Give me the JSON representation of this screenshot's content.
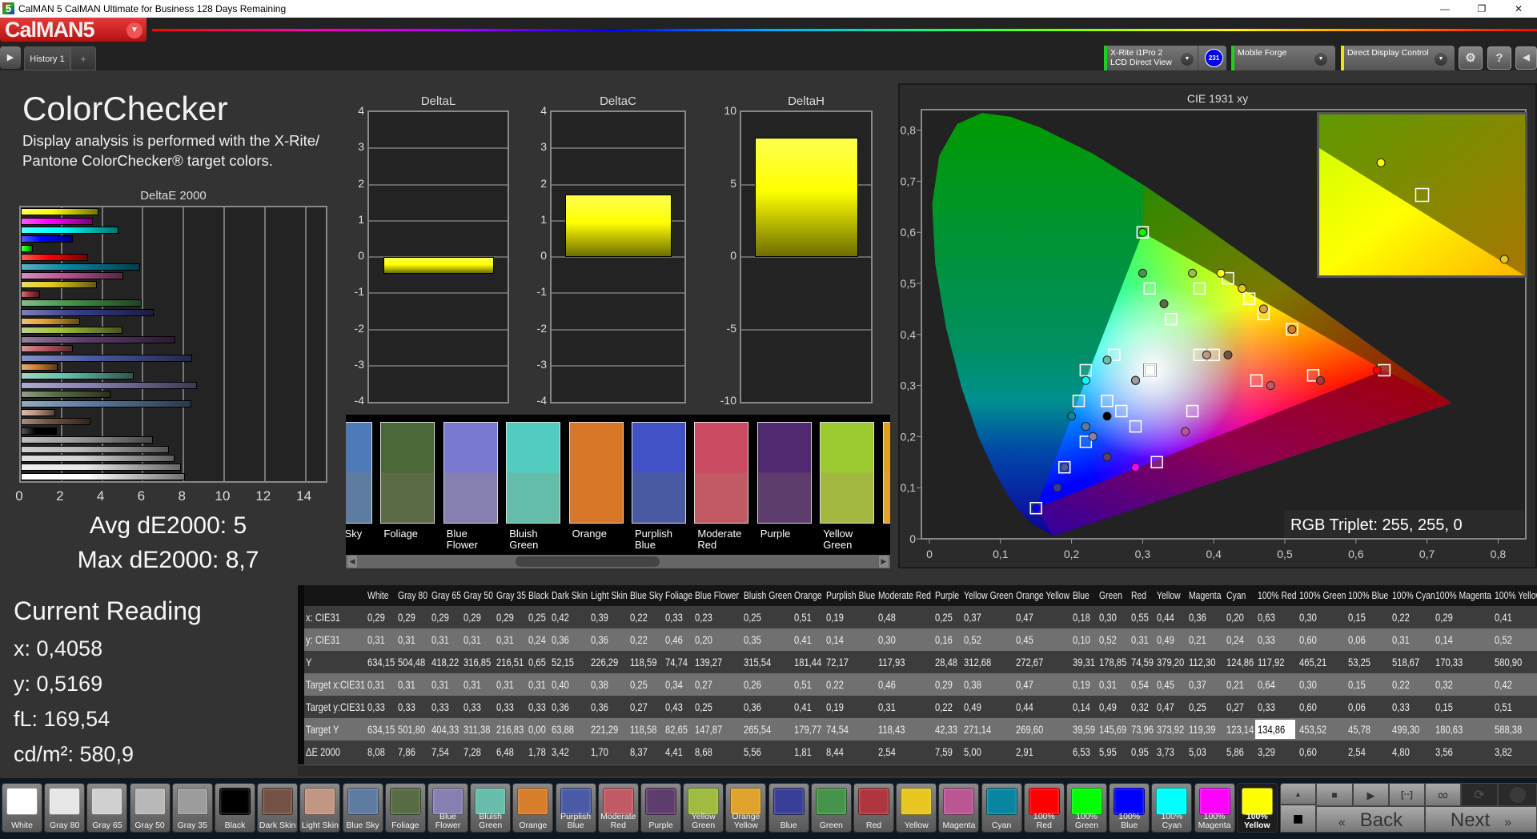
{
  "window": {
    "title": "CalMAN 5 CalMAN Ultimate for Business 128 Days Remaining",
    "app_icon": "5",
    "minimize": "—",
    "restore": "❐",
    "close": "✕"
  },
  "header": {
    "logo": "CalMAN5",
    "logo_menu_icon": "chevron-down"
  },
  "tabs": {
    "play_icon": "▶",
    "items": [
      {
        "label": "History 1"
      }
    ],
    "add": "+"
  },
  "devices": {
    "meter": {
      "line1": "X-Rite i1Pro 2",
      "line2": "LCD Direct View",
      "badge": "231",
      "status_color": "#22cc22"
    },
    "source": {
      "label": "Mobile Forge",
      "status_color": "#22cc22"
    },
    "display": {
      "label": "Direct Display Control",
      "status_color": "#e8e800"
    },
    "settings_icon": "⚙",
    "help_icon": "?",
    "back_icon": "◀"
  },
  "colors": {
    "logo_red": "#d32020",
    "badge_blue": "#0000ee",
    "panel_bg": "#333333",
    "plot_bg": "#232323"
  },
  "left": {
    "title": "ColorChecker",
    "desc_line1": "Display analysis is performed with the X-Rite/",
    "desc_line2": "Pantone ColorChecker® target colors.",
    "avg": "Avg dE2000: 5",
    "max": "Max dE2000: 8,7"
  },
  "current_reading": {
    "title": "Current Reading",
    "x": "x: 0,4058",
    "y": "y: 0,5169",
    "fl": "fL: 169,54",
    "cdm2": "cd/m²: 580,9"
  },
  "patches": [
    {
      "name": "White",
      "color": "#ffffff"
    },
    {
      "name": "Gray 80",
      "color": "#e6e6e6"
    },
    {
      "name": "Gray 65",
      "color": "#d0d0d0"
    },
    {
      "name": "Gray 50",
      "color": "#b8b8b8"
    },
    {
      "name": "Gray 35",
      "color": "#9c9c9c"
    },
    {
      "name": "Black",
      "color": "#000000"
    },
    {
      "name": "Dark Skin",
      "color": "#735244"
    },
    {
      "name": "Light Skin",
      "color": "#c29682"
    },
    {
      "name": "Blue Sky",
      "color": "#5e7ba0"
    },
    {
      "name": "Foliage",
      "color": "#576c43"
    },
    {
      "name": "Blue Flower",
      "color": "#8580b1"
    },
    {
      "name": "Bluish Green",
      "color": "#67bdaa"
    },
    {
      "name": "Orange",
      "color": "#d67e2c"
    },
    {
      "name": "Purplish Blue",
      "color": "#4a5aa6"
    },
    {
      "name": "Moderate Red",
      "color": "#c15a63"
    },
    {
      "name": "Purple",
      "color": "#5e3c6c"
    },
    {
      "name": "Yellow Green",
      "color": "#9dbc40"
    },
    {
      "name": "Orange Yellow",
      "color": "#e0a32e"
    },
    {
      "name": "Blue",
      "color": "#383d96"
    },
    {
      "name": "Green",
      "color": "#469449"
    },
    {
      "name": "Red",
      "color": "#af363c"
    },
    {
      "name": "Yellow",
      "color": "#e7c71f"
    },
    {
      "name": "Magenta",
      "color": "#bb5695"
    },
    {
      "name": "Cyan",
      "color": "#0885a1"
    },
    {
      "name": "100% Red",
      "color": "#ff0000"
    },
    {
      "name": "100% Green",
      "color": "#00ff00"
    },
    {
      "name": "100% Blue",
      "color": "#0000ff"
    },
    {
      "name": "100% Cyan",
      "color": "#00ffff"
    },
    {
      "name": "100% Magenta",
      "color": "#ff00ff"
    },
    {
      "name": "100% Yellow",
      "color": "#ffff00"
    }
  ],
  "selected_patch": "100% Yellow",
  "table": {
    "columns": [
      "White",
      "Gray 80",
      "Gray 65",
      "Gray 50",
      "Gray 35",
      "Black",
      "Dark Skin",
      "Light Skin",
      "Blue Sky",
      "Foliage",
      "Blue Flower",
      "Bluish Green",
      "Orange",
      "Purplish Blue",
      "Moderate Red",
      "Purple",
      "Yellow Green",
      "Orange Yellow",
      "Blue",
      "Green",
      "Red",
      "Yellow",
      "Magenta",
      "Cyan",
      "100% Red",
      "100% Green",
      "100% Blue",
      "100% Cyan",
      "100% Magenta",
      "100% Yellow"
    ],
    "rows": [
      {
        "label": "x: CIE31",
        "values": [
          "0,29",
          "0,29",
          "0,29",
          "0,29",
          "0,29",
          "0,25",
          "0,42",
          "0,39",
          "0,22",
          "0,33",
          "0,23",
          "0,25",
          "0,51",
          "0,19",
          "0,48",
          "0,25",
          "0,37",
          "0,47",
          "0,18",
          "0,30",
          "0,55",
          "0,44",
          "0,36",
          "0,20",
          "0,63",
          "0,30",
          "0,15",
          "0,22",
          "0,29",
          "0,41"
        ]
      },
      {
        "label": "y: CIE31",
        "values": [
          "0,31",
          "0,31",
          "0,31",
          "0,31",
          "0,31",
          "0,24",
          "0,36",
          "0,36",
          "0,22",
          "0,46",
          "0,20",
          "0,35",
          "0,41",
          "0,14",
          "0,30",
          "0,16",
          "0,52",
          "0,45",
          "0,10",
          "0,52",
          "0,31",
          "0,49",
          "0,21",
          "0,24",
          "0,33",
          "0,60",
          "0,06",
          "0,31",
          "0,14",
          "0,52"
        ]
      },
      {
        "label": "Y",
        "values": [
          "634,15",
          "504,48",
          "418,22",
          "316,85",
          "216,51",
          "0,65",
          "52,15",
          "226,29",
          "118,59",
          "74,74",
          "139,27",
          "315,54",
          "181,44",
          "72,17",
          "117,93",
          "28,48",
          "312,68",
          "272,67",
          "39,31",
          "178,85",
          "74,59",
          "379,20",
          "112,30",
          "124,86",
          "117,92",
          "465,21",
          "53,25",
          "518,67",
          "170,33",
          "580,90"
        ]
      },
      {
        "label": "Target x:CIE31",
        "values": [
          "0,31",
          "0,31",
          "0,31",
          "0,31",
          "0,31",
          "0,31",
          "0,40",
          "0,38",
          "0,25",
          "0,34",
          "0,27",
          "0,26",
          "0,51",
          "0,22",
          "0,46",
          "0,29",
          "0,38",
          "0,47",
          "0,19",
          "0,31",
          "0,54",
          "0,45",
          "0,37",
          "0,21",
          "0,64",
          "0,30",
          "0,15",
          "0,22",
          "0,32",
          "0,42"
        ]
      },
      {
        "label": "Target y:CIE31",
        "values": [
          "0,33",
          "0,33",
          "0,33",
          "0,33",
          "0,33",
          "0,33",
          "0,36",
          "0,36",
          "0,27",
          "0,43",
          "0,25",
          "0,36",
          "0,41",
          "0,19",
          "0,31",
          "0,22",
          "0,49",
          "0,44",
          "0,14",
          "0,49",
          "0,32",
          "0,47",
          "0,25",
          "0,27",
          "0,33",
          "0,60",
          "0,06",
          "0,33",
          "0,15",
          "0,51"
        ]
      },
      {
        "label": "Target Y",
        "values": [
          "634,15",
          "501,80",
          "404,33",
          "311,38",
          "216,83",
          "0,00",
          "63,88",
          "221,29",
          "118,58",
          "82,65",
          "147,87",
          "265,54",
          "179,77",
          "74,54",
          "118,43",
          "42,33",
          "271,14",
          "269,60",
          "39,59",
          "145,69",
          "73,96",
          "373,92",
          "119,39",
          "123,14",
          "134,86",
          "453,52",
          "45,78",
          "499,30",
          "180,63",
          "588,38"
        ]
      },
      {
        "label": "ΔE 2000",
        "values": [
          "8,08",
          "7,86",
          "7,54",
          "7,28",
          "6,48",
          "1,78",
          "3,42",
          "1,70",
          "8,37",
          "4,41",
          "8,68",
          "5,56",
          "1,81",
          "8,44",
          "2,54",
          "7,59",
          "5,00",
          "2,91",
          "6,53",
          "5,95",
          "0,95",
          "3,73",
          "5,03",
          "5,86",
          "3,29",
          "0,60",
          "2,54",
          "4,80",
          "3,56",
          "3,82"
        ]
      }
    ]
  },
  "strip": [
    {
      "label": "Blue Sky",
      "measured": "#4f7ab8",
      "target": "#5e7ba0"
    },
    {
      "label": "Foliage",
      "measured": "#4a6838",
      "target": "#5b6b45"
    },
    {
      "label": "Blue Flower",
      "measured": "#7878d0",
      "target": "#8580b1"
    },
    {
      "label": "Bluish Green",
      "measured": "#50cdc0",
      "target": "#64bca9"
    },
    {
      "label": "Orange",
      "measured": "#d87826",
      "target": "#d87826"
    },
    {
      "label": "Purplish Blue",
      "measured": "#4152c4",
      "target": "#4a5aa2"
    },
    {
      "label": "Moderate Red",
      "measured": "#ca4a64",
      "target": "#c15a63"
    },
    {
      "label": "Purple",
      "measured": "#522a72",
      "target": "#5e3c6c"
    },
    {
      "label": "Yellow Green",
      "measured": "#9aca30",
      "target": "#a3b840"
    },
    {
      "label": "",
      "measured": "#e0a020",
      "target": "#e0a32e"
    }
  ],
  "controls": {
    "up_icon": "▲",
    "stop_icon": "■",
    "play_icon": "▶",
    "bracket_icon": "[··]",
    "loop_icon": "∞",
    "refresh_icon": "⟳",
    "back": "Back",
    "next": "Next",
    "back_icon": "«",
    "next_icon": "»"
  },
  "chart_data": [
    {
      "type": "bar",
      "orientation": "horizontal",
      "title": "DeltaE 2000",
      "categories": [
        "White",
        "Gray 80",
        "Gray 65",
        "Gray 50",
        "Gray 35",
        "Black",
        "Dark Skin",
        "Light Skin",
        "Blue Sky",
        "Foliage",
        "Blue Flower",
        "Bluish Green",
        "Orange",
        "Purplish Blue",
        "Moderate Red",
        "Purple",
        "Yellow Green",
        "Orange Yellow",
        "Blue",
        "Green",
        "Red",
        "Yellow",
        "Magenta",
        "Cyan",
        "100% Red",
        "100% Green",
        "100% Blue",
        "100% Cyan",
        "100% Magenta",
        "100% Yellow"
      ],
      "values": [
        8.08,
        7.86,
        7.54,
        7.28,
        6.48,
        1.78,
        3.42,
        1.7,
        8.37,
        4.41,
        8.68,
        5.56,
        1.81,
        8.44,
        2.54,
        7.59,
        5.0,
        2.91,
        6.53,
        5.95,
        0.95,
        3.73,
        5.03,
        5.86,
        3.29,
        0.6,
        2.54,
        4.8,
        3.56,
        3.82
      ],
      "xlim": [
        0,
        15
      ],
      "xticks": [
        0,
        2,
        4,
        6,
        8,
        10,
        12,
        14
      ],
      "xtick_labels": [
        "0",
        "2",
        "4",
        "6",
        "8",
        "10",
        "12",
        "14"
      ],
      "grid": true
    },
    {
      "type": "bar",
      "title": "DeltaL",
      "values": [
        -0.47
      ],
      "ylim": [
        -4,
        4
      ],
      "yticks": [
        4,
        3,
        2,
        1,
        0,
        -1,
        -2,
        -3,
        -4
      ],
      "ytick_labels": [
        "4",
        "3",
        "2",
        "1",
        "0",
        "-1",
        "-2",
        "-3",
        "-4"
      ],
      "color": "#ffff00"
    },
    {
      "type": "bar",
      "title": "DeltaC",
      "values": [
        1.73
      ],
      "ylim": [
        -4,
        4
      ],
      "yticks": [
        4,
        3,
        2,
        1,
        0,
        -1,
        -2,
        -3,
        -4
      ],
      "ytick_labels": [
        "4",
        "3",
        "2",
        "1",
        "0",
        "-1",
        "-2",
        "-3",
        "-4"
      ],
      "color": "#ffff00"
    },
    {
      "type": "bar",
      "title": "DeltaH",
      "values": [
        8.25
      ],
      "ylim": [
        -10,
        10
      ],
      "yticks": [
        10,
        5,
        0,
        -5,
        -10
      ],
      "ytick_labels": [
        "10",
        "5",
        "0",
        "-5",
        "-10"
      ],
      "color": "#ffff00"
    },
    {
      "type": "scatter",
      "title": "CIE 1931 xy",
      "xlim": [
        0,
        0.84
      ],
      "ylim": [
        0,
        0.84
      ],
      "xticks": [
        0,
        0.1,
        0.2,
        0.3,
        0.4,
        0.5,
        0.6,
        0.7,
        0.8
      ],
      "xtick_labels": [
        "0",
        "0,1",
        "0,2",
        "0,3",
        "0,4",
        "0,5",
        "0,6",
        "0,7",
        "0,8"
      ],
      "yticks": [
        0,
        0.1,
        0.2,
        0.3,
        0.4,
        0.5,
        0.6,
        0.7,
        0.8
      ],
      "ytick_labels": [
        "0",
        "0,1",
        "0,2",
        "0,3",
        "0,4",
        "0,5",
        "0,6",
        "0,7",
        "0,8"
      ],
      "gamut": [
        [
          0.64,
          0.33
        ],
        [
          0.3,
          0.6
        ],
        [
          0.15,
          0.06
        ]
      ],
      "measured": [
        [
          0.29,
          0.31
        ],
        [
          0.29,
          0.31
        ],
        [
          0.29,
          0.31
        ],
        [
          0.29,
          0.31
        ],
        [
          0.29,
          0.31
        ],
        [
          0.25,
          0.24
        ],
        [
          0.42,
          0.36
        ],
        [
          0.39,
          0.36
        ],
        [
          0.22,
          0.22
        ],
        [
          0.33,
          0.46
        ],
        [
          0.23,
          0.2
        ],
        [
          0.25,
          0.35
        ],
        [
          0.51,
          0.41
        ],
        [
          0.19,
          0.14
        ],
        [
          0.48,
          0.3
        ],
        [
          0.25,
          0.16
        ],
        [
          0.37,
          0.52
        ],
        [
          0.47,
          0.45
        ],
        [
          0.18,
          0.1
        ],
        [
          0.3,
          0.52
        ],
        [
          0.55,
          0.31
        ],
        [
          0.44,
          0.49
        ],
        [
          0.36,
          0.21
        ],
        [
          0.2,
          0.24
        ],
        [
          0.63,
          0.33
        ],
        [
          0.3,
          0.6
        ],
        [
          0.15,
          0.06
        ],
        [
          0.22,
          0.31
        ],
        [
          0.29,
          0.14
        ],
        [
          0.41,
          0.52
        ]
      ],
      "target": [
        [
          0.31,
          0.33
        ],
        [
          0.31,
          0.33
        ],
        [
          0.31,
          0.33
        ],
        [
          0.31,
          0.33
        ],
        [
          0.31,
          0.33
        ],
        [
          0.31,
          0.33
        ],
        [
          0.4,
          0.36
        ],
        [
          0.38,
          0.36
        ],
        [
          0.25,
          0.27
        ],
        [
          0.34,
          0.43
        ],
        [
          0.27,
          0.25
        ],
        [
          0.26,
          0.36
        ],
        [
          0.51,
          0.41
        ],
        [
          0.22,
          0.19
        ],
        [
          0.46,
          0.31
        ],
        [
          0.29,
          0.22
        ],
        [
          0.38,
          0.49
        ],
        [
          0.47,
          0.44
        ],
        [
          0.19,
          0.14
        ],
        [
          0.31,
          0.49
        ],
        [
          0.54,
          0.32
        ],
        [
          0.45,
          0.47
        ],
        [
          0.37,
          0.25
        ],
        [
          0.21,
          0.27
        ],
        [
          0.64,
          0.33
        ],
        [
          0.3,
          0.6
        ],
        [
          0.15,
          0.06
        ],
        [
          0.22,
          0.33
        ],
        [
          0.32,
          0.15
        ],
        [
          0.42,
          0.51
        ]
      ],
      "annotation": "RGB Triplet: 255, 255, 0"
    }
  ]
}
